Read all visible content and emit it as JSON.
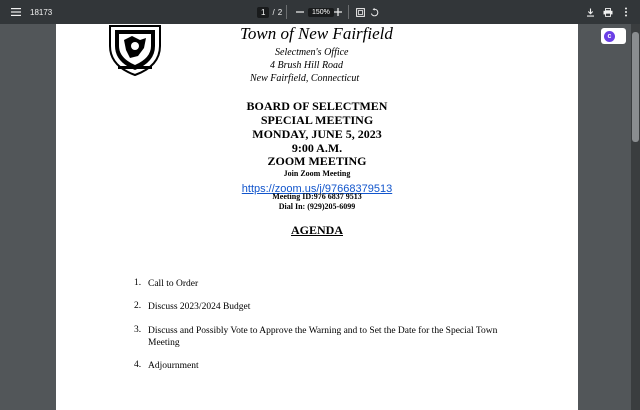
{
  "toolbar": {
    "doc_title": "18173",
    "page_current": "1",
    "page_separator": "/",
    "page_total": "2",
    "zoom": "150%"
  },
  "extension": {
    "badge_letter": "c"
  },
  "letterhead": {
    "town": "Town of New Fairfield",
    "office": "Selectmen's Office",
    "address": "4 Brush Hill Road",
    "city": "New Fairfield, Connecticut"
  },
  "meeting": {
    "board": "BOARD OF SELECTMEN",
    "type": "SPECIAL MEETING",
    "date": "MONDAY, JUNE 5, 2023",
    "time": "9:00 A.M.",
    "format": "ZOOM MEETING",
    "join_label": "Join Zoom Meeting",
    "zoom_link": "https://zoom.us/j/97668379513",
    "meeting_id": "Meeting ID:976 6837 9513",
    "dial_in": "Dial In: (929)205-6099"
  },
  "agenda": {
    "title": "AGENDA",
    "items": [
      {
        "num": "1.",
        "text": "Call to Order"
      },
      {
        "num": "2.",
        "text": "Discuss 2023/2024 Budget"
      },
      {
        "num": "3.",
        "text": "Discuss and Possibly Vote to Approve the Warning and to Set the Date for the Special Town Meeting"
      },
      {
        "num": "4.",
        "text": "Adjournment"
      }
    ]
  }
}
